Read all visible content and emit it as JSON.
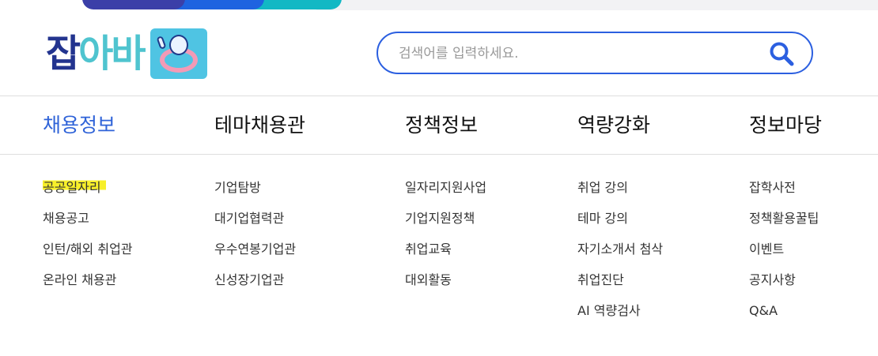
{
  "search": {
    "placeholder": "검색어를 입력하세요.",
    "value": ""
  },
  "logo": {
    "part1": "잡",
    "part2": "아바"
  },
  "nav": {
    "tabs": [
      {
        "label": "채용정보",
        "active": true
      },
      {
        "label": "테마채용관",
        "active": false
      },
      {
        "label": "정책정보",
        "active": false
      },
      {
        "label": "역량강화",
        "active": false
      },
      {
        "label": "정보마당",
        "active": false
      }
    ]
  },
  "menu": {
    "columns": [
      {
        "items": [
          "공공일자리",
          "채용공고",
          "인턴/해외 취업관",
          "온라인 채용관"
        ]
      },
      {
        "items": [
          "기업탐방",
          "대기업협력관",
          "우수연봉기업관",
          "신성장기업관"
        ]
      },
      {
        "items": [
          "일자리지원사업",
          "기업지원정책",
          "취업교육",
          "대외활동"
        ]
      },
      {
        "items": [
          "취업 강의",
          "테마 강의",
          "자기소개서 첨삭",
          "취업진단",
          "AI 역량검사"
        ]
      },
      {
        "items": [
          "잡학사전",
          "정책활용꿀팁",
          "이벤트",
          "공지사항",
          "Q&A"
        ]
      }
    ]
  },
  "colors": {
    "accent": "#2f63d8",
    "highlight": "#f7ef2a",
    "logo_dark": "#23348f",
    "logo_light": "#4fc4cf"
  },
  "icons": {
    "search": "search-icon",
    "mascot": "mascot-logo"
  }
}
